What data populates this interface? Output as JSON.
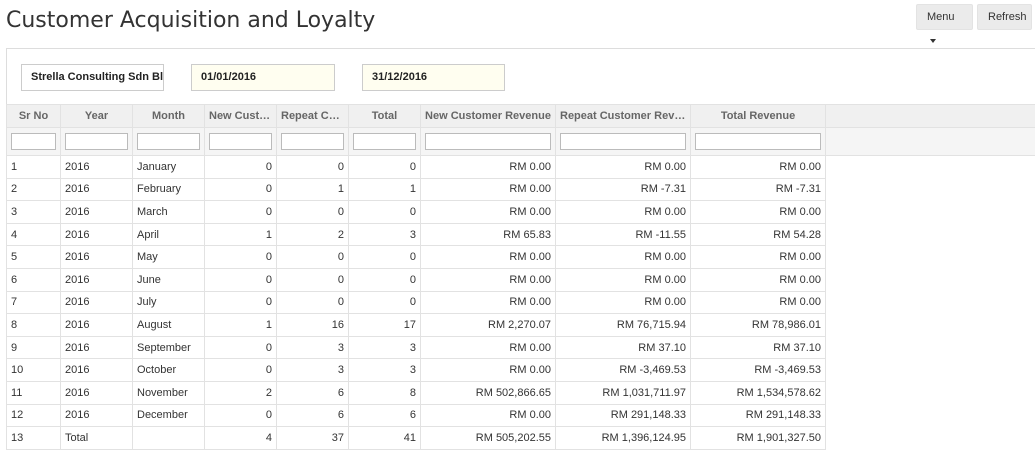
{
  "header": {
    "title": "Customer Acquisition and Loyalty",
    "menu_label": "Menu",
    "refresh_label": "Refresh"
  },
  "filters": {
    "company": "Strella Consulting Sdn Bl",
    "start_date": "01/01/2016",
    "end_date": "31/12/2016"
  },
  "columns": [
    "Sr No",
    "Year",
    "Month",
    "New Custo...",
    "Repeat Cus...",
    "Total",
    "New Customer Revenue",
    "Repeat Customer Reve...",
    "Total Revenue"
  ],
  "rows": [
    [
      "1",
      "2016",
      "January",
      "0",
      "0",
      "0",
      "RM 0.00",
      "RM 0.00",
      "RM 0.00"
    ],
    [
      "2",
      "2016",
      "February",
      "0",
      "1",
      "1",
      "RM 0.00",
      "RM -7.31",
      "RM -7.31"
    ],
    [
      "3",
      "2016",
      "March",
      "0",
      "0",
      "0",
      "RM 0.00",
      "RM 0.00",
      "RM 0.00"
    ],
    [
      "4",
      "2016",
      "April",
      "1",
      "2",
      "3",
      "RM 65.83",
      "RM -11.55",
      "RM 54.28"
    ],
    [
      "5",
      "2016",
      "May",
      "0",
      "0",
      "0",
      "RM 0.00",
      "RM 0.00",
      "RM 0.00"
    ],
    [
      "6",
      "2016",
      "June",
      "0",
      "0",
      "0",
      "RM 0.00",
      "RM 0.00",
      "RM 0.00"
    ],
    [
      "7",
      "2016",
      "July",
      "0",
      "0",
      "0",
      "RM 0.00",
      "RM 0.00",
      "RM 0.00"
    ],
    [
      "8",
      "2016",
      "August",
      "1",
      "16",
      "17",
      "RM 2,270.07",
      "RM 76,715.94",
      "RM 78,986.01"
    ],
    [
      "9",
      "2016",
      "September",
      "0",
      "3",
      "3",
      "RM 0.00",
      "RM 37.10",
      "RM 37.10"
    ],
    [
      "10",
      "2016",
      "October",
      "0",
      "3",
      "3",
      "RM 0.00",
      "RM -3,469.53",
      "RM -3,469.53"
    ],
    [
      "11",
      "2016",
      "November",
      "2",
      "6",
      "8",
      "RM 502,866.65",
      "RM 1,031,711.97",
      "RM 1,534,578.62"
    ],
    [
      "12",
      "2016",
      "December",
      "0",
      "6",
      "6",
      "RM 0.00",
      "RM 291,148.33",
      "RM 291,148.33"
    ],
    [
      "13",
      "Total",
      "",
      "4",
      "37",
      "41",
      "RM 505,202.55",
      "RM 1,396,124.95",
      "RM 1,901,327.50"
    ]
  ]
}
